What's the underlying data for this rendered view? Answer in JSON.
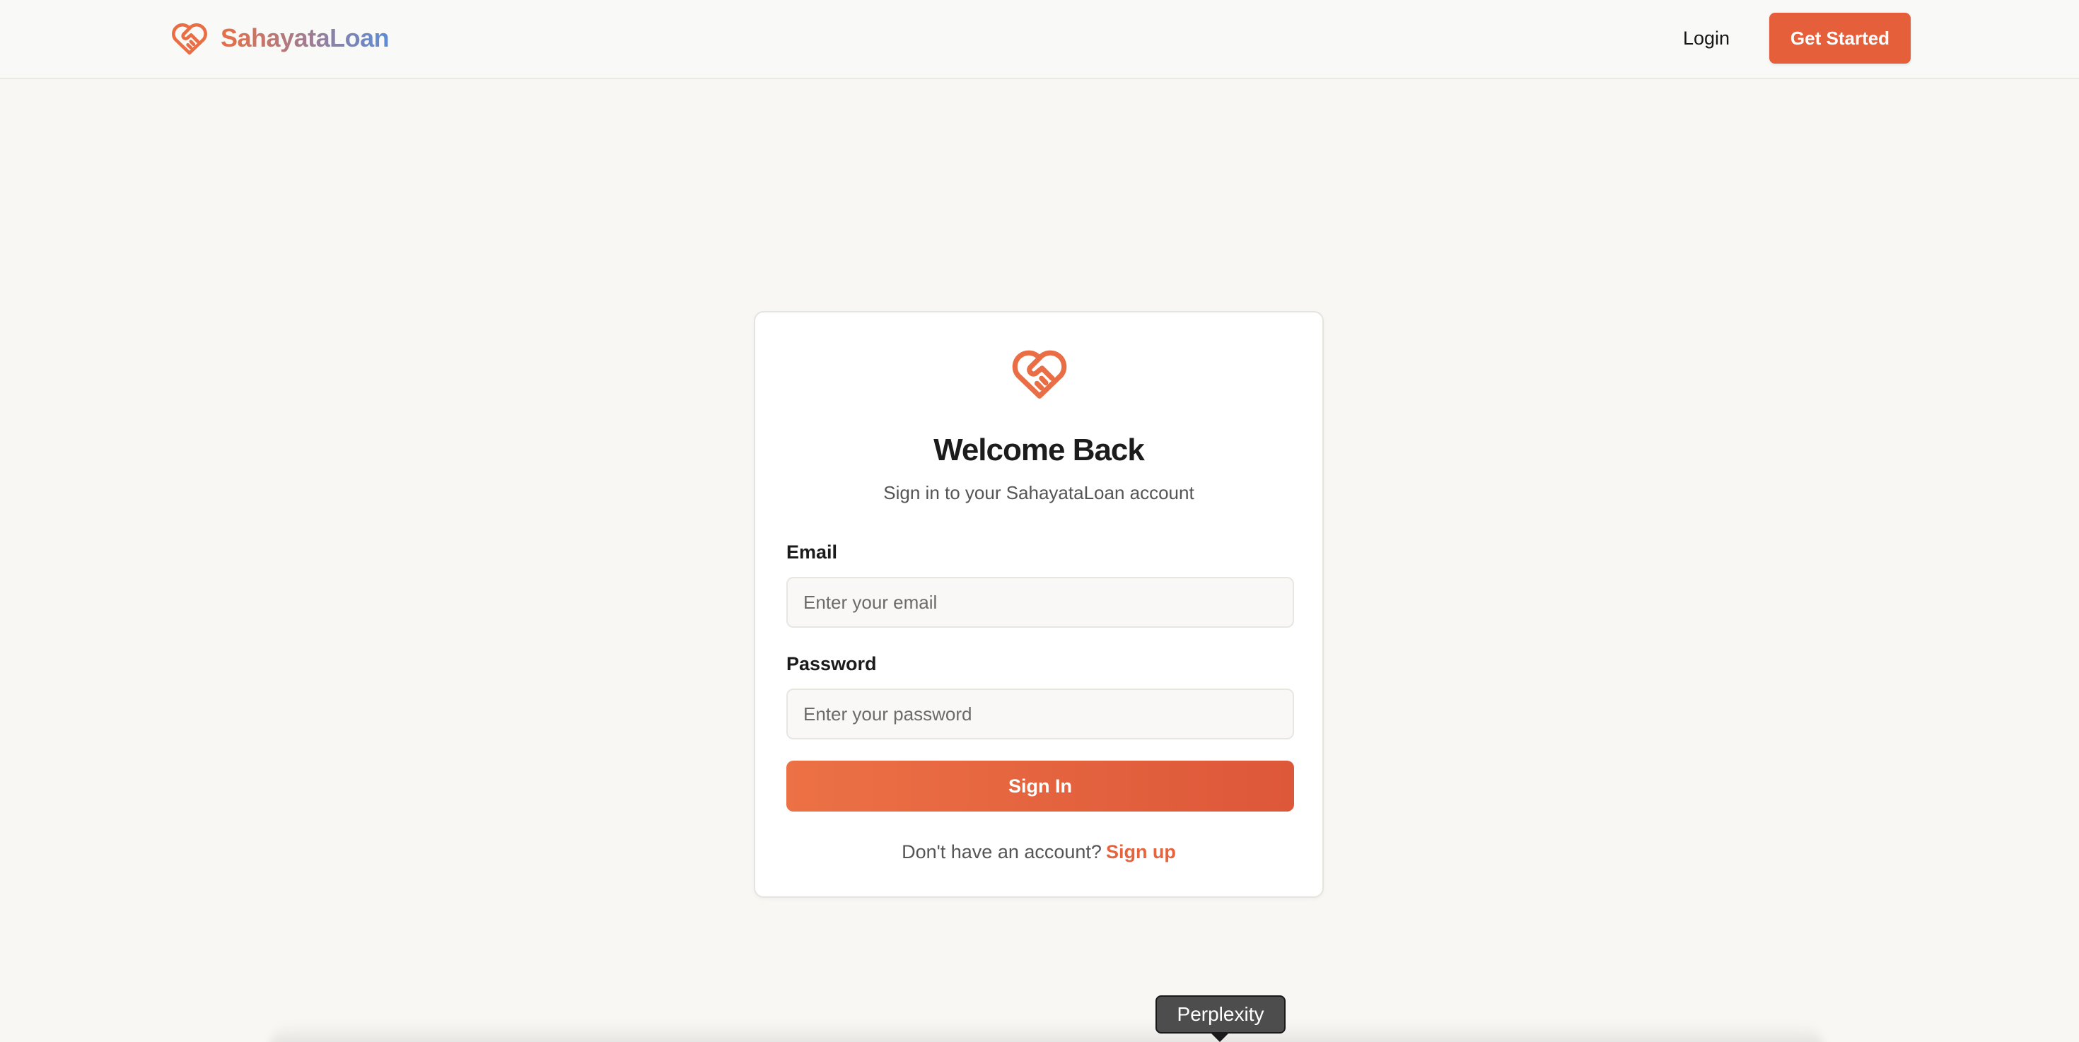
{
  "header": {
    "brand_name": "SahayataLoan",
    "brand_icon": "heart-handshake-icon",
    "login_label": "Login",
    "cta_label": "Get Started"
  },
  "card": {
    "icon": "heart-handshake-icon",
    "title": "Welcome Back",
    "subtitle": "Sign in to your SahayataLoan account",
    "email_label": "Email",
    "email_placeholder": "Enter your email",
    "email_value": "",
    "password_label": "Password",
    "password_placeholder": "Enter your password",
    "password_value": "",
    "signin_label": "Sign In",
    "signup_prompt": "Don't have an account?",
    "signup_link": "Sign up"
  },
  "tooltip": {
    "text": "Perplexity"
  },
  "colors": {
    "accent": "#e65f3b",
    "brand_gradient_start": "#e96e45",
    "brand_gradient_end": "#5b8cd8",
    "background": "#f8f7f4"
  }
}
